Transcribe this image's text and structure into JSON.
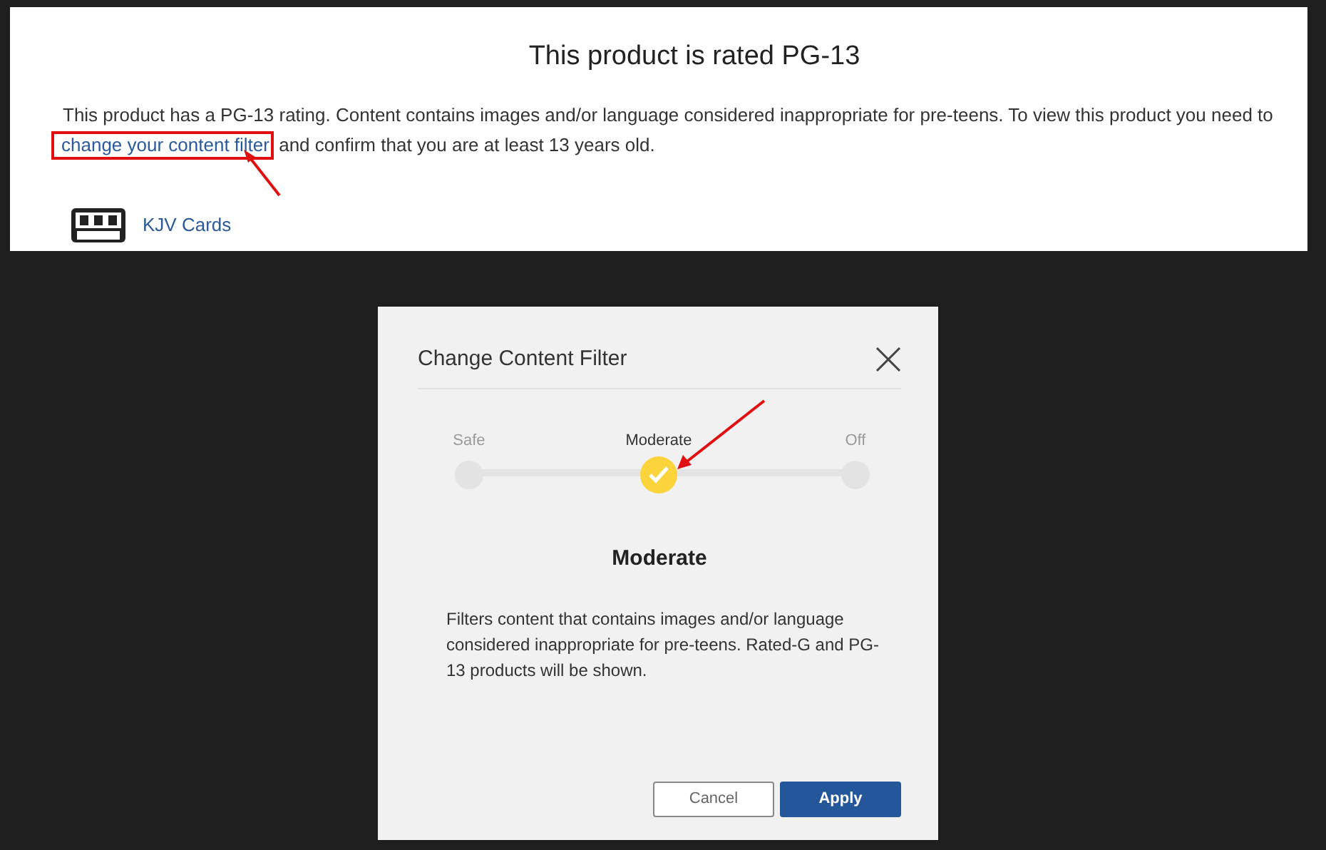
{
  "product_notice": {
    "title": "This product is rated PG-13",
    "message_before": "This product has a PG-13 rating. Content contains images and/or language considered inappropriate for pre-teens. To view this product you need to",
    "link": "change your content filter",
    "message_after": "and confirm that you are at least 13 years old.",
    "seller": "KJV Cards"
  },
  "dialog": {
    "title": "Change Content Filter",
    "stops": [
      {
        "label": "Safe",
        "selected": false
      },
      {
        "label": "Moderate",
        "selected": true
      },
      {
        "label": "Off",
        "selected": false
      }
    ],
    "level_title": "Moderate",
    "description": "Filters content that contains images and/or language considered inappropriate for pre-teens. Rated-G and PG-13 products will be shown.",
    "buttons": [
      {
        "label": "Cancel",
        "kind": "secondary"
      },
      {
        "label": "Apply",
        "kind": "primary"
      }
    ]
  }
}
